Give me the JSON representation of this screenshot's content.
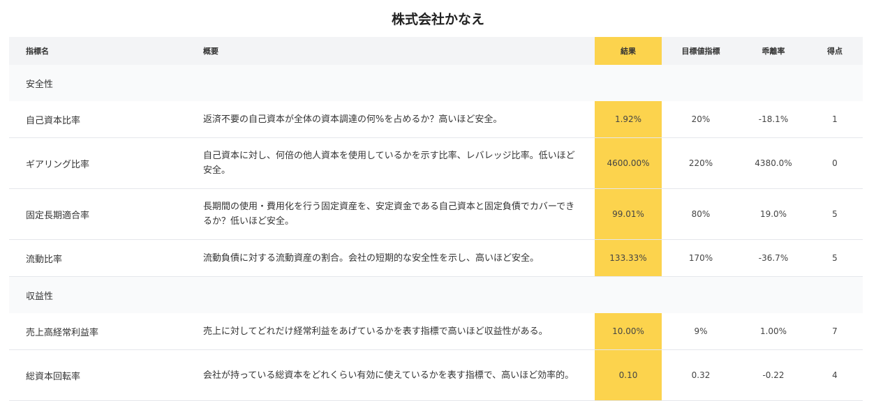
{
  "page": {
    "title": "株式会社かなえ"
  },
  "colors": {
    "highlight": "#fcd34d",
    "header_bg": "#f3f4f6",
    "section_bg": "#f9fafb"
  },
  "table": {
    "headers": {
      "name": "指標名",
      "description": "概要",
      "result": "結果",
      "target": "目標値指標",
      "deviation": "乖離率",
      "score": "得点"
    },
    "sections": [
      {
        "label": "安全性",
        "rows": [
          {
            "name": "自己資本比率",
            "description": "返済不要の自己資本が全体の資本調達の何%を占めるか？高いほど安全。",
            "result": "1.92%",
            "target": "20%",
            "deviation": "-18.1%",
            "score": "1"
          },
          {
            "name": "ギアリング比率",
            "description": "自己資本に対し、何倍の他人資本を使用しているかを示す比率、レバレッジ比率。低いほど安全。",
            "result": "4600.00%",
            "target": "220%",
            "deviation": "4380.0%",
            "score": "0"
          },
          {
            "name": "固定長期適合率",
            "description": "長期間の使用・費用化を行う固定資産を、安定資金である自己資本と固定負債でカバーできるか？低いほど安全。",
            "result": "99.01%",
            "target": "80%",
            "deviation": "19.0%",
            "score": "5"
          },
          {
            "name": "流動比率",
            "description": "流動負債に対する流動資産の割合。会社の短期的な安全性を示し、高いほど安全。",
            "result": "133.33%",
            "target": "170%",
            "deviation": "-36.7%",
            "score": "5"
          }
        ]
      },
      {
        "label": "収益性",
        "rows": [
          {
            "name": "売上高経常利益率",
            "description": "売上に対してどれだけ経常利益をあげているかを表す指標で高いほど収益性がある。",
            "result": "10.00%",
            "target": "9%",
            "deviation": "1.00%",
            "score": "7"
          },
          {
            "name": "総資本回転率",
            "description": "会社が持っている総資本をどれくらい有効に使えているかを表す指標で、高いほど効率的。",
            "result": "0.10",
            "target": "0.32",
            "deviation": "-0.22",
            "score": "4"
          }
        ]
      }
    ]
  }
}
